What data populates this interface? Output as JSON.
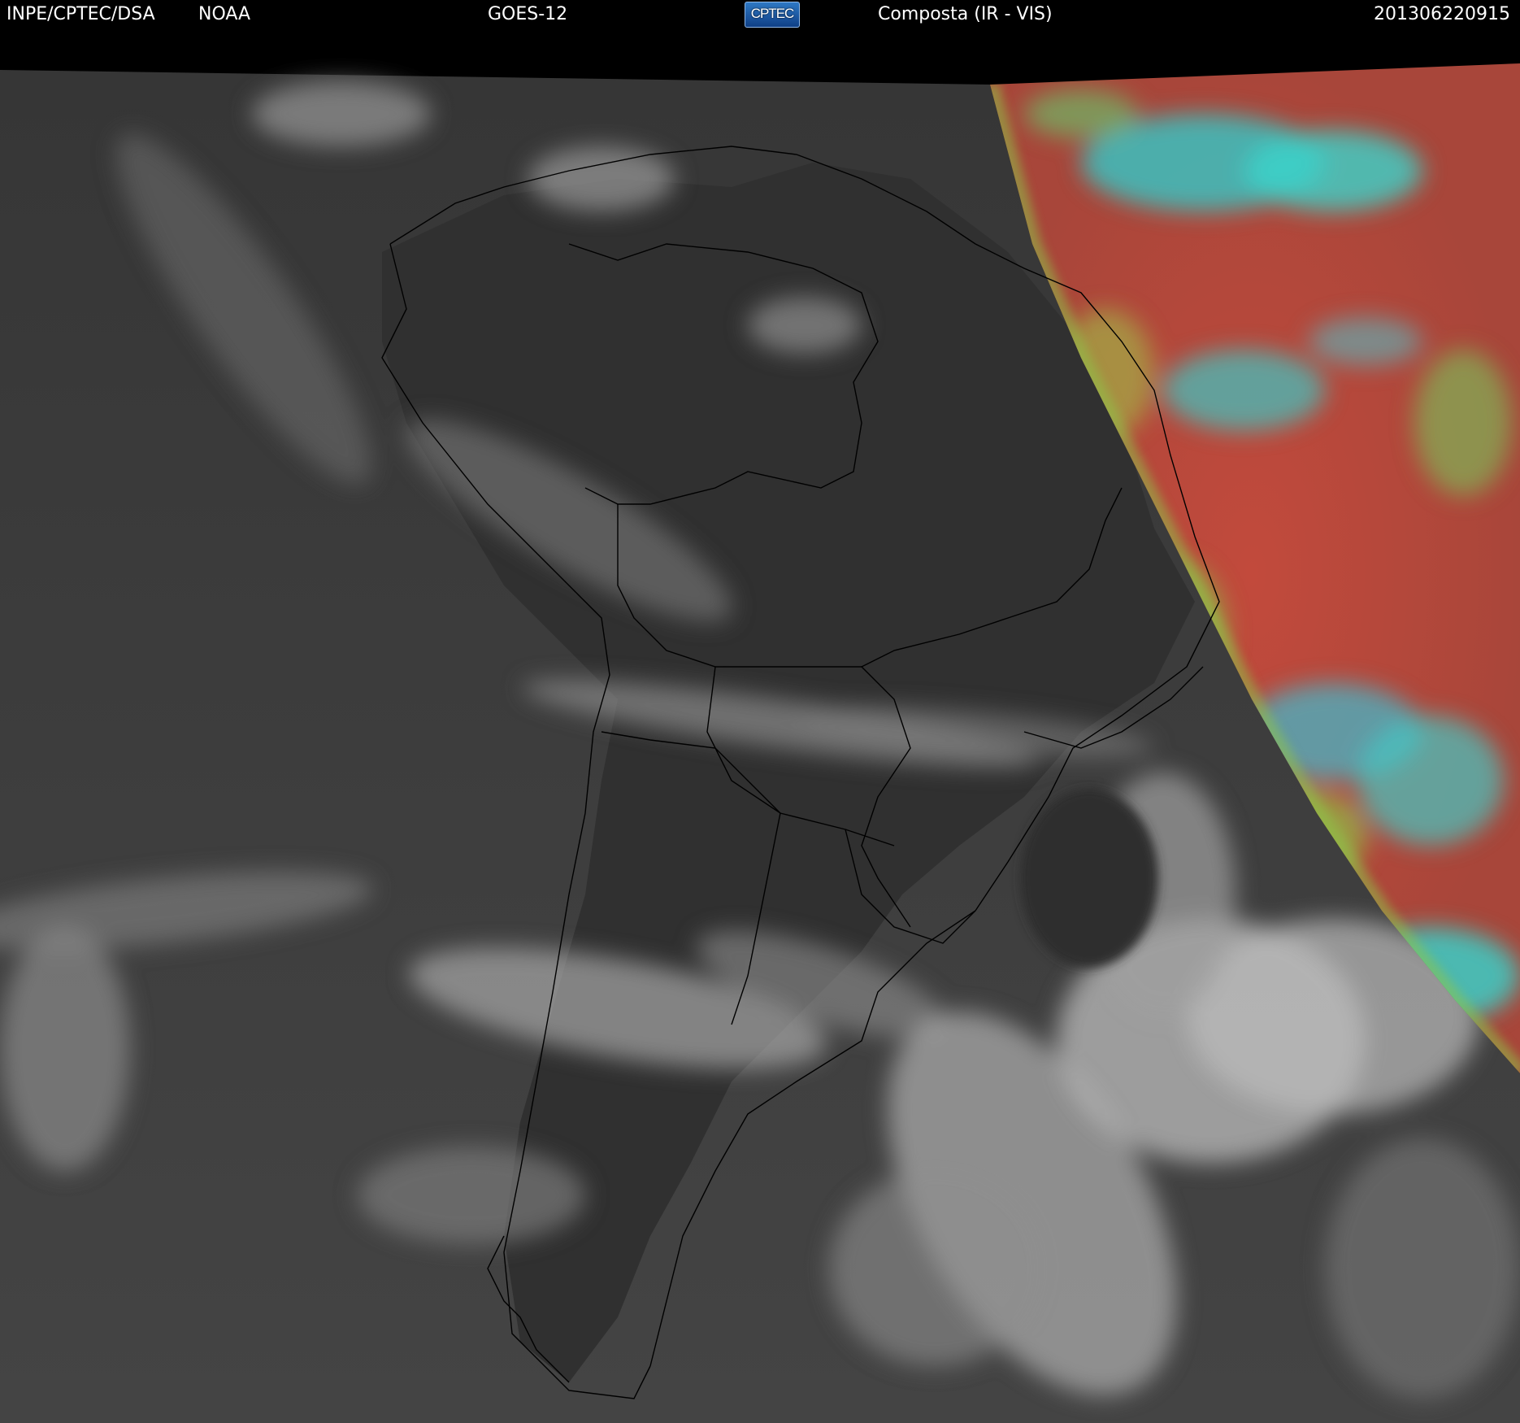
{
  "header": {
    "agency": "INPE/CPTEC/DSA",
    "provider": "NOAA",
    "satellite": "GOES-12",
    "logo_text": "CPTEC",
    "product": "Composta (IR - VIS)",
    "timestamp": "201306220915"
  },
  "colors": {
    "background": "#000000",
    "header_text": "#ffffff",
    "ir_gray": "#3c3c3c",
    "cloud_white": "#d8d8d8",
    "vis_red": "#b8473a",
    "vis_green": "#8ec44a",
    "vis_cyan": "#37d8d0",
    "coastline": "#000000"
  }
}
